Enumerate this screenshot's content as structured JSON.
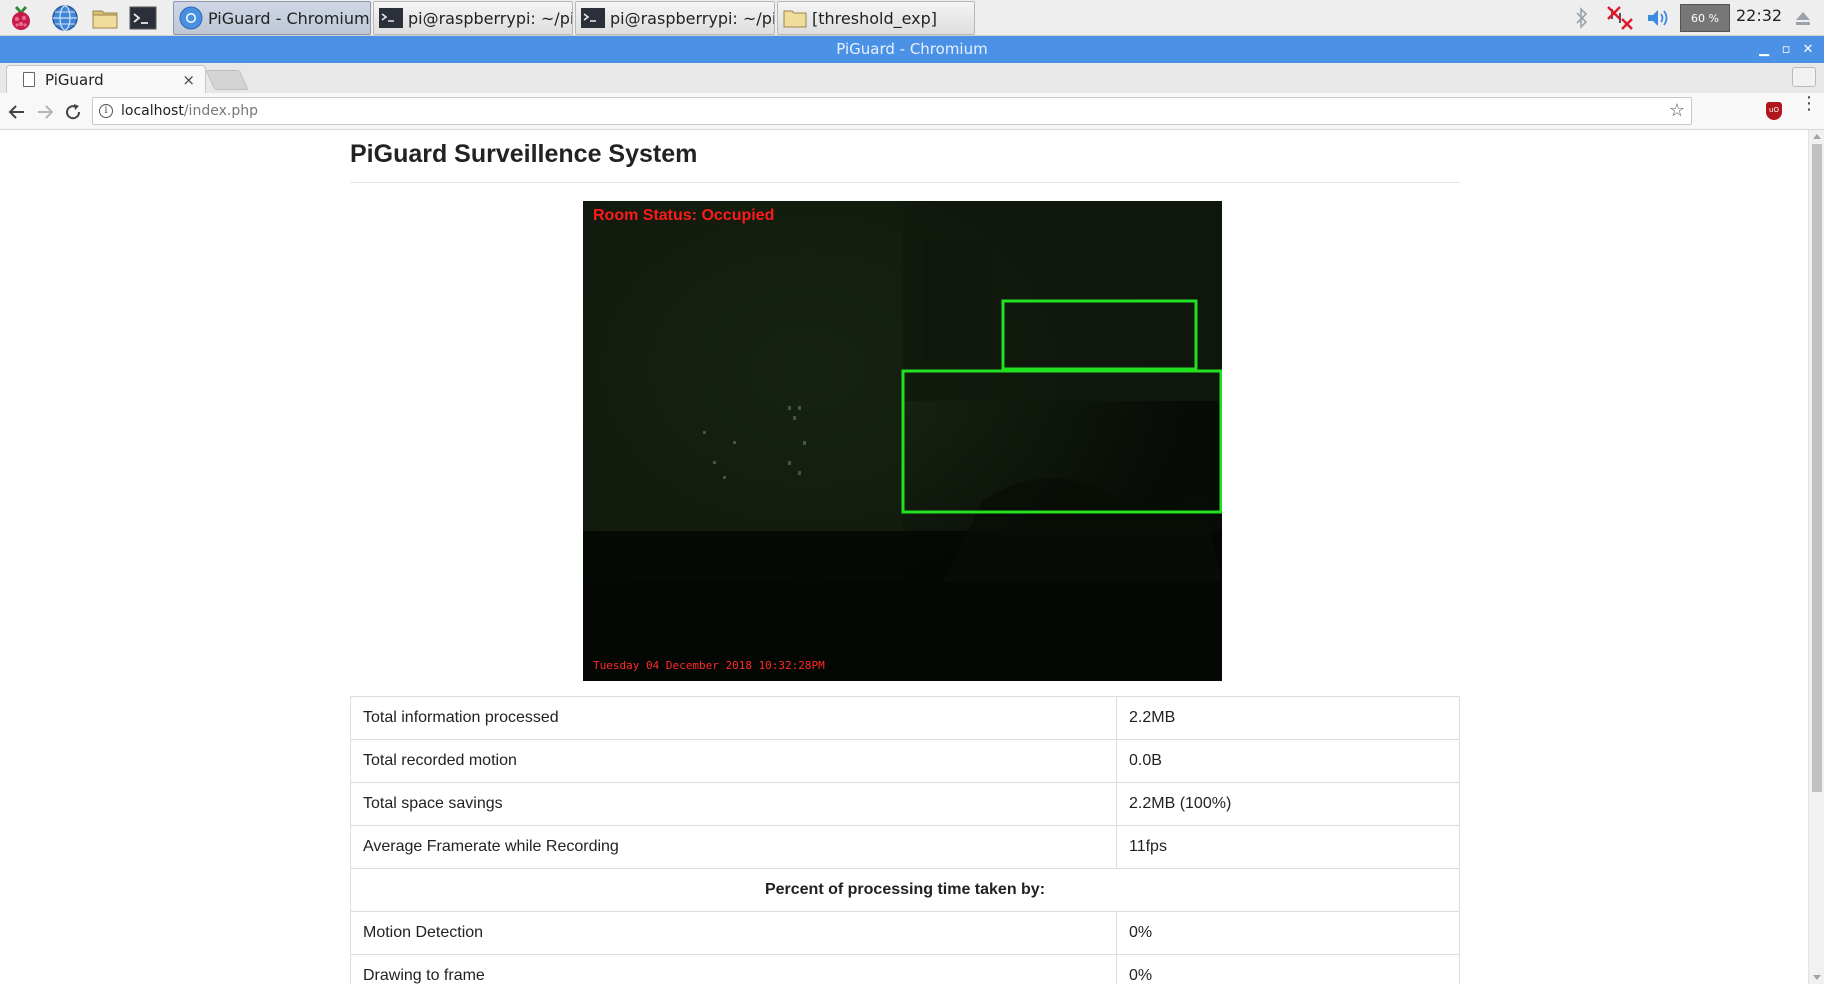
{
  "taskbar": {
    "tasks": [
      {
        "label": "PiGuard - Chromium",
        "active": true
      },
      {
        "label": "pi@raspberrypi: ~/pig...",
        "active": false
      },
      {
        "label": "pi@raspberrypi: ~/pig...",
        "active": false
      },
      {
        "label": "[threshold_exp]",
        "active": false
      }
    ],
    "cpu": "60 %",
    "clock": "22:32"
  },
  "window": {
    "title": "PiGuard - Chromium"
  },
  "browser": {
    "tab_title": "PiGuard",
    "tab_close": "×",
    "url_host": "localhost",
    "url_path": "/index.php"
  },
  "page": {
    "title": "PiGuard Surveillence System",
    "camera": {
      "room_status": "Room Status: Occupied",
      "timestamp": "Tuesday 04 December 2018 10:32:28PM"
    },
    "stats": [
      {
        "label": "Total information processed",
        "value": "2.2MB"
      },
      {
        "label": "Total recorded motion",
        "value": "0.0B"
      },
      {
        "label": "Total space savings",
        "value": "2.2MB (100%)"
      },
      {
        "label": "Average Framerate while Recording",
        "value": "11fps"
      }
    ],
    "processing_header": "Percent of processing time taken by:",
    "processing": [
      {
        "label": "Motion Detection",
        "value": "0%"
      },
      {
        "label": "Drawing to frame",
        "value": "0%"
      }
    ]
  },
  "colors": {
    "titlebar": "#4b92e6",
    "motion_box": "#22e022",
    "overlay_text": "#ff1a1a"
  }
}
